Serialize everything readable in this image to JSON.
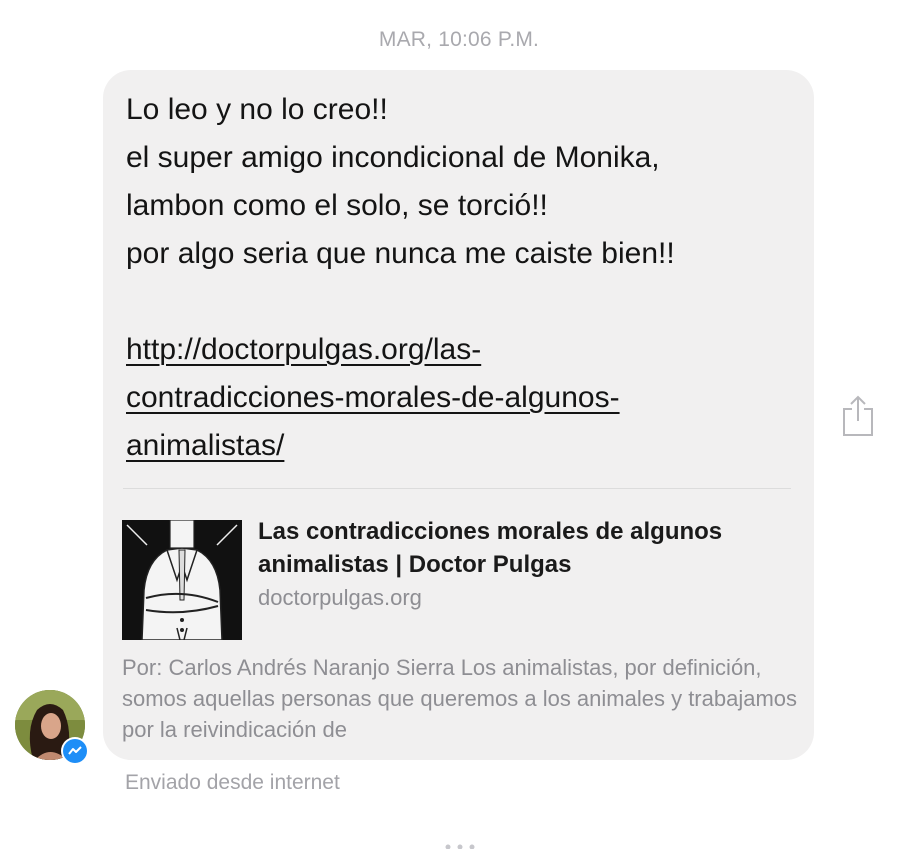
{
  "conversation": {
    "timestamp": "MAR, 10:06 P.M.",
    "message": {
      "lines": [
        "Lo leo y no lo creo!!",
        "el super amigo incondicional de Monika,",
        "lambon como el solo, se torció!!",
        "por algo seria que nunca me caiste bien!!"
      ],
      "link_lines": [
        "http://doctorpulgas.org/las-",
        "contradicciones-morales-de-algunos-",
        "animalistas/"
      ]
    },
    "link_preview": {
      "title": "Las contradicciones morales de algunos animalistas | Doctor Pulgas",
      "domain": "doctorpulgas.org",
      "description": "Por: Carlos Andrés Naranjo Sierra Los animalistas, por definición, somos aquellas personas que queremos a los animales y trabajamos por la reivindicación de",
      "thumbnail_icon": "illustration-thumbnail"
    },
    "footer": {
      "sent_from": "Enviado desde internet"
    },
    "icons": {
      "share": "share-icon",
      "messenger_badge": "messenger-icon",
      "avatar": "avatar"
    },
    "colors": {
      "bubble": "#f1f0f0",
      "messenger_blue": "#1e8ef7",
      "muted_text": "#8e8e93"
    }
  }
}
